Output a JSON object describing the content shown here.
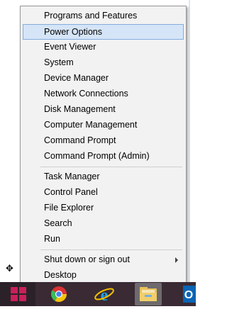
{
  "menu": {
    "items": [
      {
        "label": "Programs and Features"
      },
      {
        "label": "Power Options"
      },
      {
        "label": "Event Viewer"
      },
      {
        "label": "System"
      },
      {
        "label": "Device Manager"
      },
      {
        "label": "Network Connections"
      },
      {
        "label": "Disk Management"
      },
      {
        "label": "Computer Management"
      },
      {
        "label": "Command Prompt"
      },
      {
        "label": "Command Prompt (Admin)"
      },
      {
        "label": "Task Manager"
      },
      {
        "label": "Control Panel"
      },
      {
        "label": "File Explorer"
      },
      {
        "label": "Search"
      },
      {
        "label": "Run"
      },
      {
        "label": "Shut down or sign out"
      },
      {
        "label": "Desktop"
      }
    ],
    "highlighted_item": "Power Options"
  },
  "taskbar": {
    "icons": [
      "windows-logo-icon",
      "chrome-icon",
      "internet-explorer-icon",
      "file-explorer-icon",
      "outlook-icon"
    ]
  },
  "colors": {
    "menu_background": "#f2f2f2",
    "highlight_background": "#d5e5f7",
    "highlight_border": "#84acdd",
    "taskbar_background": "#3a2a33",
    "start_accent": "#c9205a"
  }
}
